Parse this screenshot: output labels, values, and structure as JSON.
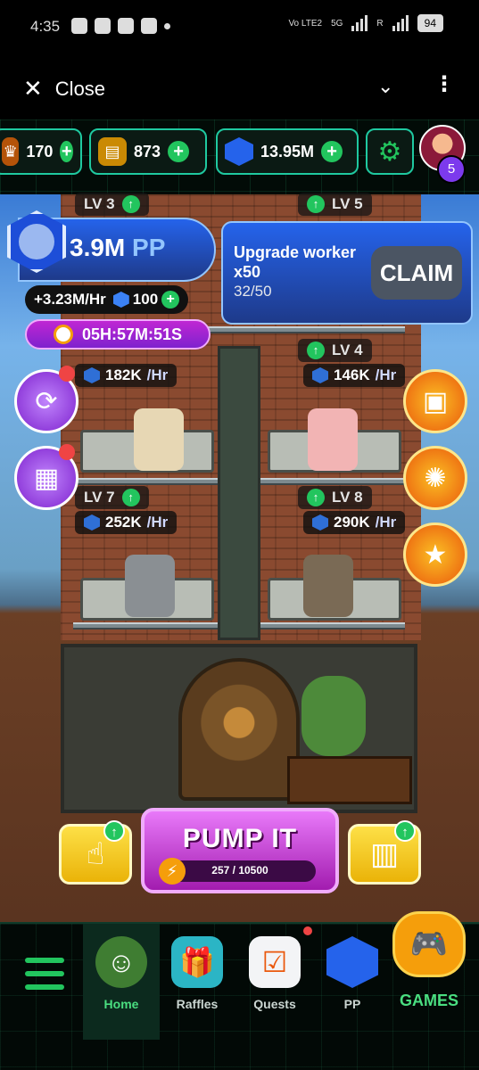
{
  "status_bar": {
    "time": "4:35",
    "network_label": "Vo LTE2",
    "net_5g": "5G",
    "roaming": "R",
    "battery": "94"
  },
  "title_bar": {
    "close_label": "Close",
    "close_icon": "close-icon",
    "chevron_icon": "chevron-down-icon",
    "more_icon": "more-vertical-icon"
  },
  "currencies": {
    "crowns": "170",
    "cash": "873",
    "pp": "13.95M",
    "settings_icon": "gear-icon",
    "avatar_badge": "5"
  },
  "tower": {
    "floors": [
      {
        "level": "LV 3"
      },
      {
        "level": "LV 5"
      },
      {
        "level": "LV 4",
        "rate": "146K",
        "rate_unit": "/Hr"
      },
      {
        "rate": "182K",
        "rate_unit": "/Hr"
      },
      {
        "level": "LV 7",
        "rate": "252K",
        "rate_unit": "/Hr"
      },
      {
        "level": "LV 8",
        "rate": "290K",
        "rate_unit": "/Hr"
      }
    ]
  },
  "pp_panel": {
    "amount": "3.9M",
    "unit": "PP",
    "rate": "+3.23M/Hr",
    "level": "100",
    "timer": "05H:57M:51S"
  },
  "upgrade_card": {
    "title": "Upgrade worker x50",
    "progress_text": "32/50",
    "claim_label": "CLAIM"
  },
  "actions": {
    "pump_label": "PUMP IT",
    "energy_text": "257 / 10500",
    "energy_current": 257,
    "energy_max": 10500
  },
  "bottom_nav": {
    "items": [
      {
        "label": "Home",
        "active": true
      },
      {
        "label": "Raffles"
      },
      {
        "label": "Quests"
      },
      {
        "label": "PP"
      }
    ],
    "games_label": "GAMES"
  },
  "colors": {
    "accent_green": "#22c55e",
    "panel_blue": "#1e3a8a",
    "pump_magenta": "#a21caf"
  }
}
